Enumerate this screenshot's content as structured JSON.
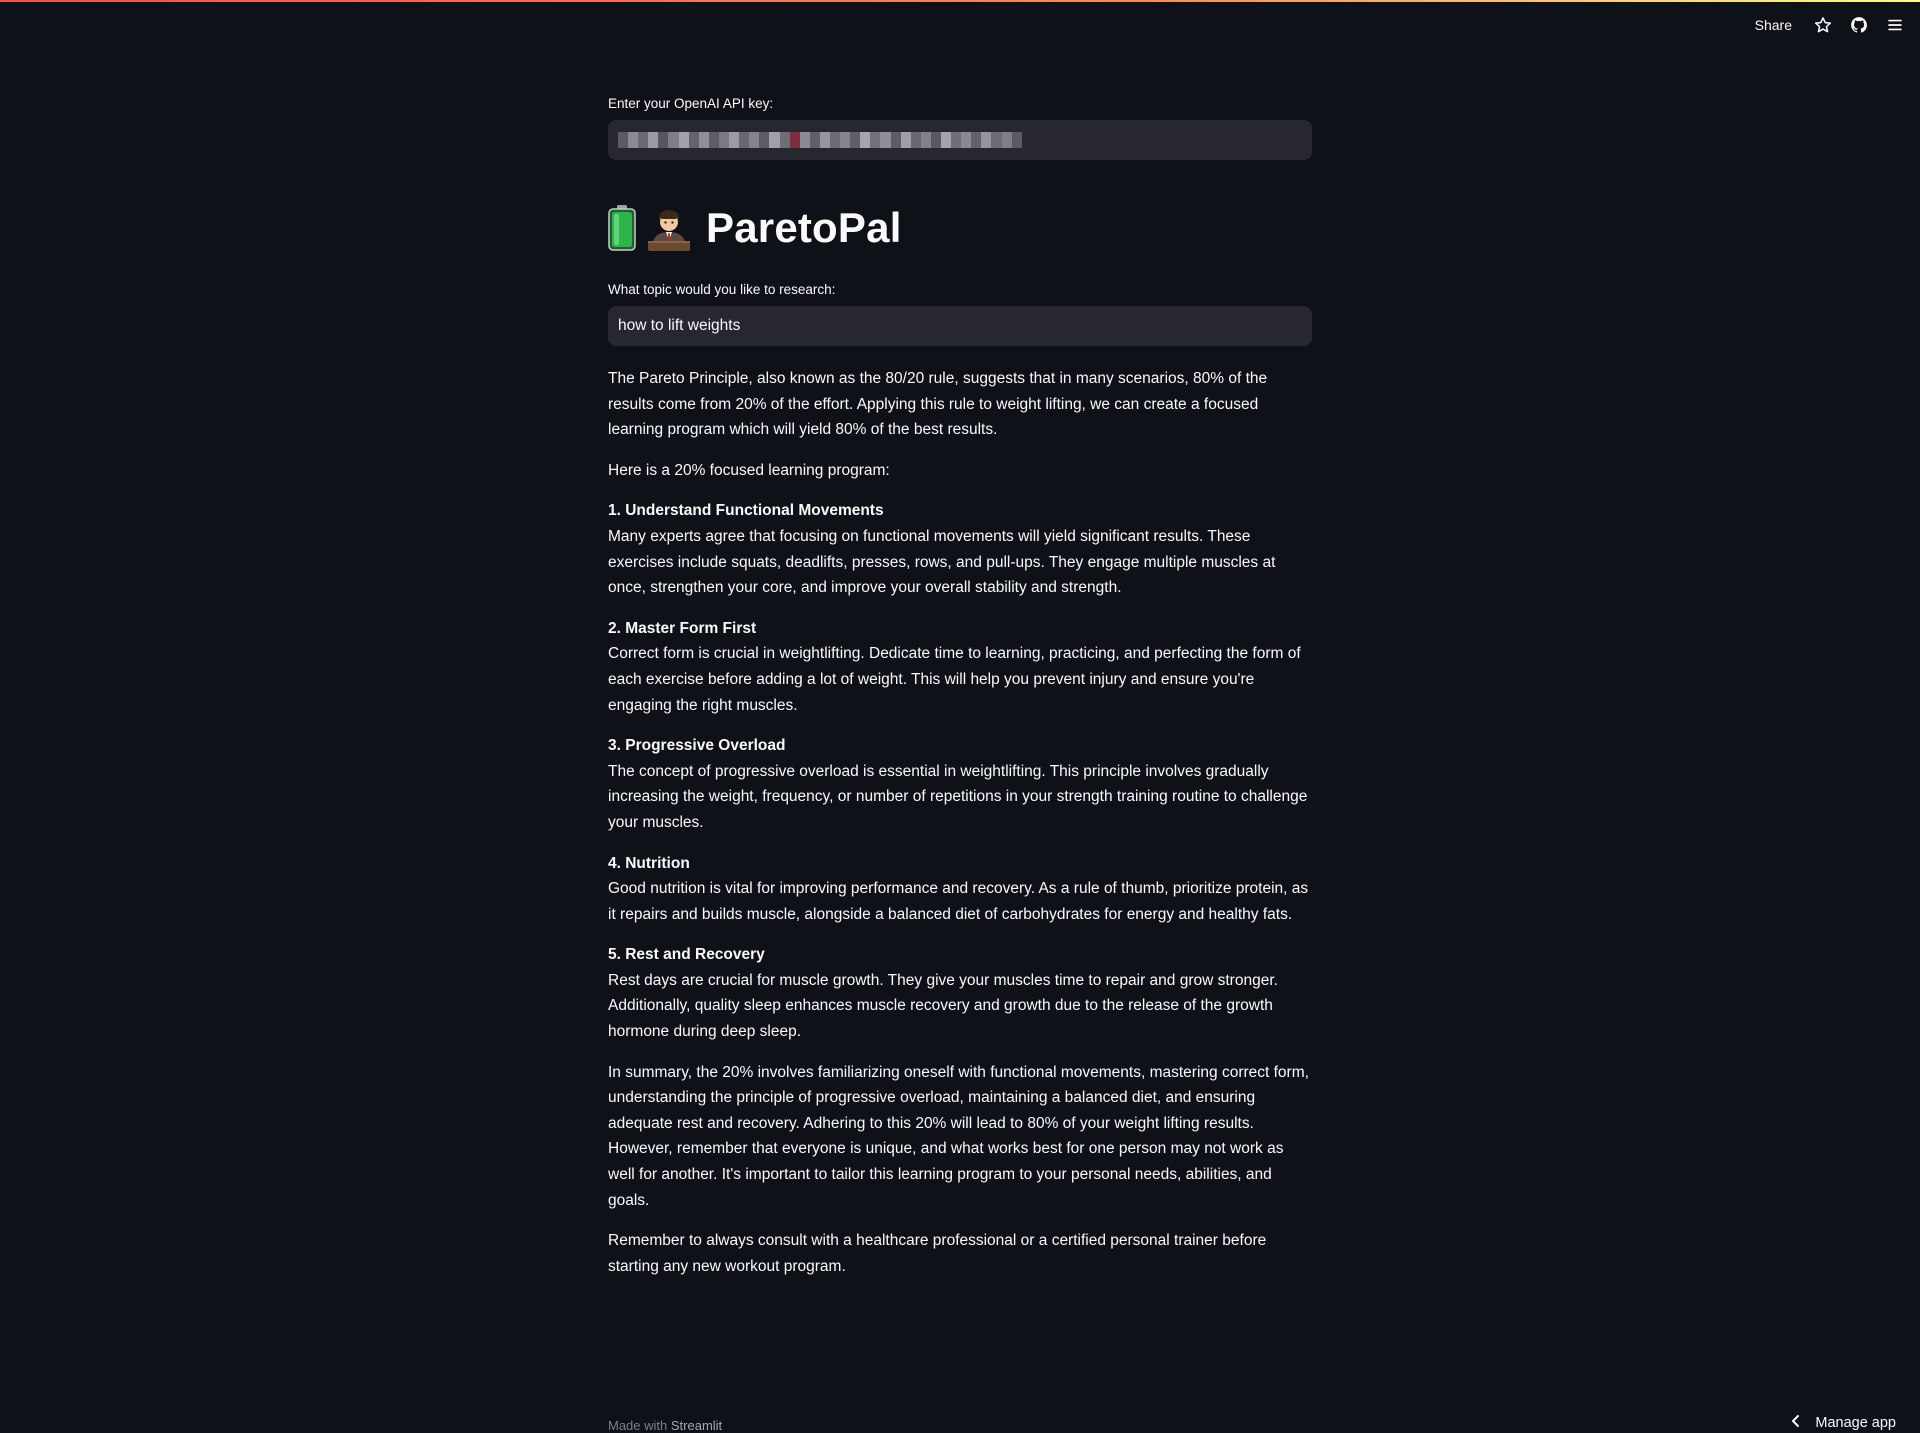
{
  "header": {
    "share_label": "Share",
    "icons": [
      "star-icon",
      "github-icon",
      "menu-icon"
    ]
  },
  "api_key": {
    "label": "Enter your OpenAI API key:",
    "value_state": "masked"
  },
  "app": {
    "title": "ParetoPal",
    "title_icons": [
      "battery-icon",
      "person-at-desk-icon"
    ]
  },
  "topic": {
    "label": "What topic would you like to research:",
    "value": "how to lift weights"
  },
  "response": {
    "intro": "The Pareto Principle, also known as the 80/20 rule, suggests that in many scenarios, 80% of the results come from 20% of the effort. Applying this rule to weight lifting, we can create a focused learning program which will yield 80% of the best results.",
    "program_intro": "Here is a 20% focused learning program:",
    "items": [
      {
        "heading": "1. Understand Functional Movements",
        "body": "Many experts agree that focusing on functional movements will yield significant results. These exercises include squats, deadlifts, presses, rows, and pull-ups. They engage multiple muscles at once, strengthen your core, and improve your overall stability and strength."
      },
      {
        "heading": "2. Master Form First",
        "body": "Correct form is crucial in weightlifting. Dedicate time to learning, practicing, and perfecting the form of each exercise before adding a lot of weight. This will help you prevent injury and ensure you're engaging the right muscles."
      },
      {
        "heading": "3. Progressive Overload",
        "body": "The concept of progressive overload is essential in weightlifting. This principle involves gradually increasing the weight, frequency, or number of repetitions in your strength training routine to challenge your muscles."
      },
      {
        "heading": "4. Nutrition",
        "body": "Good nutrition is vital for improving performance and recovery. As a rule of thumb, prioritize protein, as it repairs and builds muscle, alongside a balanced diet of carbohydrates for energy and healthy fats."
      },
      {
        "heading": "5. Rest and Recovery",
        "body": "Rest days are crucial for muscle growth. They give your muscles time to repair and grow stronger. Additionally, quality sleep enhances muscle recovery and growth due to the release of the growth hormone during deep sleep."
      }
    ],
    "summary": "In summary, the 20% involves familiarizing oneself with functional movements, mastering correct form, understanding the principle of progressive overload, maintaining a balanced diet, and ensuring adequate rest and recovery. Adhering to this 20% will lead to 80% of your weight lifting results. However, remember that everyone is unique, and what works best for one person may not work as well for another. It's important to tailor this learning program to your personal needs, abilities, and goals.",
    "closing": "Remember to always consult with a healthcare professional or a certified personal trainer before starting any new workout program."
  },
  "footer": {
    "made_with": "Made with",
    "brand": "Streamlit",
    "manage_app": "Manage app"
  },
  "colors": {
    "background": "#0e1117",
    "input_background": "#262730",
    "text": "#fafafa",
    "accent_red": "#ff4b4b",
    "battery_green": "#2fb44a"
  }
}
